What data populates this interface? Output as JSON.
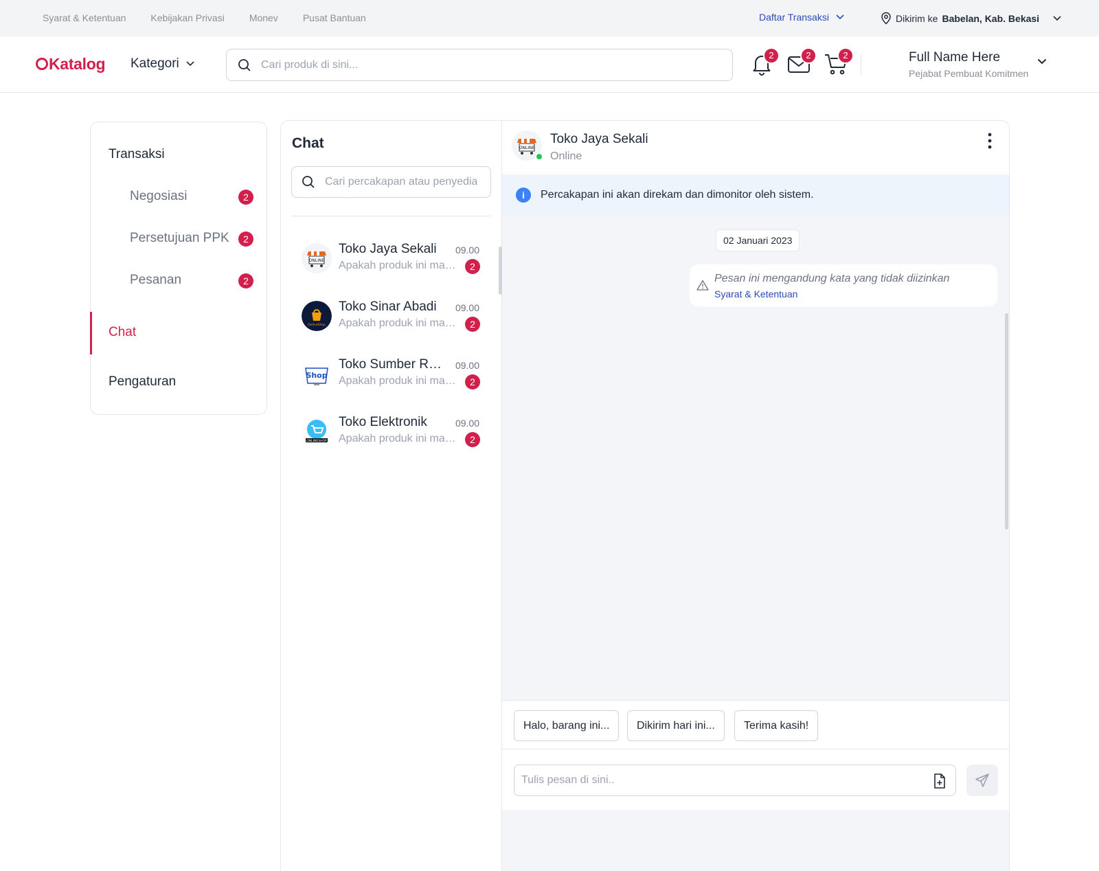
{
  "topbar": {
    "links": [
      "Syarat & Ketentuan",
      "Kebijakan Privasi",
      "Monev",
      "Pusat Bantuan"
    ],
    "daftar_transaksi": "Daftar Transaksi",
    "ship_label": "Dikirim ke",
    "ship_location": "Babelan, Kab. Bekasi"
  },
  "header": {
    "logo_text": "Katalog",
    "kategori": "Kategori",
    "search_placeholder": "Cari produk di sini...",
    "notif_count": "2",
    "mail_count": "2",
    "cart_count": "2",
    "user_name": "Full Name Here",
    "user_role": "Pejabat Pembuat Komitmen"
  },
  "sidebar": {
    "transaksi": "Transaksi",
    "items": [
      {
        "label": "Negosiasi",
        "badge": "2"
      },
      {
        "label": "Persetujuan PPK",
        "badge": "2"
      },
      {
        "label": "Pesanan",
        "badge": "2"
      }
    ],
    "chat": "Chat",
    "pengaturan": "Pengaturan"
  },
  "chat_list": {
    "title": "Chat",
    "search_placeholder": "Cari percakapan atau penyedia",
    "conversations": [
      {
        "name": "Toko Jaya Sekali",
        "time": "09.00",
        "preview": "Apakah produk ini masih tersedia?",
        "badge": "2"
      },
      {
        "name": "Toko Sinar Abadi",
        "time": "09.00",
        "preview": "Apakah produk ini masih tersedia?",
        "badge": "2"
      },
      {
        "name": "Toko Sumber Rejeki",
        "time": "09.00",
        "preview": "Apakah produk ini masih tersedia?",
        "badge": "2"
      },
      {
        "name": "Toko Elektronik",
        "time": "09.00",
        "preview": "Apakah produk ini masih tersedia?",
        "badge": "2"
      }
    ]
  },
  "conversation": {
    "name": "Toko Jaya Sekali",
    "status": "Online",
    "info_text": "Percakapan ini akan direkam dan dimonitor oleh sistem.",
    "date": "02 Januari 2023",
    "blocked_message": "Pesan ini mengandung kata yang tidak diizinkan",
    "terms_link": "Syarat & Ketentuan",
    "quick_replies": [
      "Halo, barang ini...",
      "Dikirim hari ini...",
      "Terima kasih!"
    ],
    "input_placeholder": "Tulis pesan di sini..",
    "avatar_text": "ONLINE"
  },
  "colors": {
    "brand": "#d21f4b",
    "link": "#2b4bb8",
    "online": "#22c55e",
    "info": "#3b82f6"
  }
}
